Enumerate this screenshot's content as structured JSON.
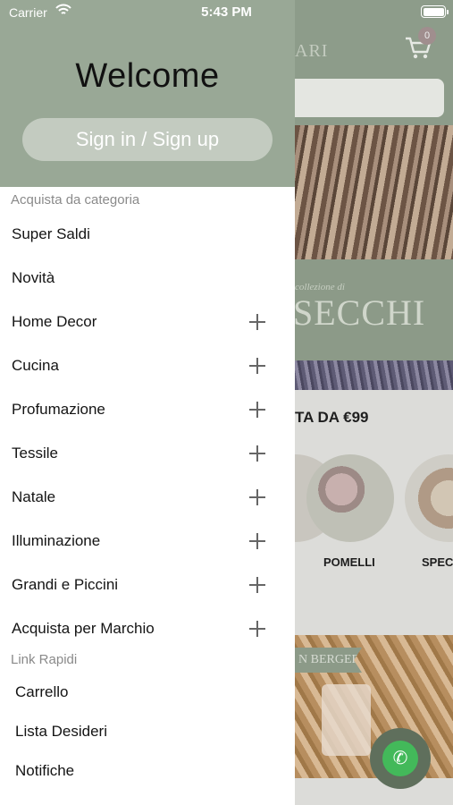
{
  "status_bar": {
    "carrier": "Carrier",
    "time": "5:43 PM"
  },
  "drawer": {
    "welcome": "Welcome",
    "signin_label": "Sign in / Sign up",
    "shop_by_category_label": "Acquista da categoria",
    "categories": [
      {
        "label": "Super Saldi",
        "expandable": false
      },
      {
        "label": "Novità",
        "expandable": false
      },
      {
        "label": "Home Decor",
        "expandable": true
      },
      {
        "label": "Cucina",
        "expandable": true
      },
      {
        "label": "Profumazione",
        "expandable": true
      },
      {
        "label": "Tessile",
        "expandable": true
      },
      {
        "label": "Natale",
        "expandable": true
      },
      {
        "label": "Illuminazione",
        "expandable": true
      },
      {
        "label": "Grandi e Piccini",
        "expandable": true
      },
      {
        "label": "Acquista per Marchio",
        "expandable": true
      }
    ],
    "quick_links_label": "Link Rapidi",
    "quick_links": [
      "Carrello",
      "Lista Desideri",
      "Notifiche"
    ]
  },
  "background": {
    "brand_fragment": "ARI",
    "cart_count": "0",
    "hero_small_text": "collezione di",
    "hero_big_text": "SECCHI",
    "promo_text": "TA DA €99",
    "category_circles": [
      "POMELLI",
      "SPEC"
    ],
    "banner_text": "N BERGER"
  },
  "colors": {
    "drawer_header": "#99a896",
    "signin_button": "#c3cbc0",
    "accent_green": "#43b95a"
  }
}
